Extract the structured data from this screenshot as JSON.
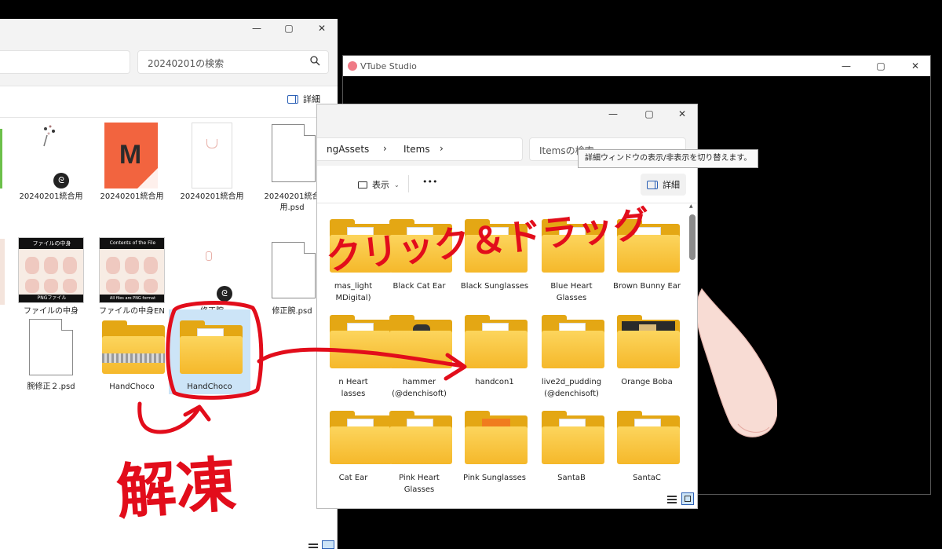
{
  "winA": {
    "search_placeholder": "20240201の検索",
    "details_label": "詳細",
    "items": [
      {
        "label": "20240201統合用"
      },
      {
        "label": "20240201統合用"
      },
      {
        "label": "20240201統合用"
      },
      {
        "label": "20240201統合用.psd"
      },
      {
        "label": "ファイルの中身"
      },
      {
        "label": "ファイルの中身EN"
      },
      {
        "label": "修正腕"
      },
      {
        "label": "修正腕.psd"
      },
      {
        "label": "腕修正２.psd"
      },
      {
        "label": "HandChoco"
      },
      {
        "label": "HandChoco"
      }
    ],
    "thumb_texts": {
      "contents_title": "Contents of the File",
      "contents_footer": "All files are PNG format",
      "jp_title": "ファイルの中身",
      "jp_footer": "PNGファイル",
      "logo_letter": "M"
    }
  },
  "winB": {
    "title": "VTube Studio"
  },
  "winC": {
    "breadcrumb_1": "ngAssets",
    "breadcrumb_2": "Items",
    "search_placeholder": "Itemsの検索",
    "view_label": "表示",
    "more_label": "•••",
    "details_label": "詳細",
    "tooltip": "詳細ウィンドウの表示/非表示を切り替えます。",
    "items": [
      {
        "label": "mas_light\nMDigital)"
      },
      {
        "label": "Black Cat Ear"
      },
      {
        "label": "Black Sunglasses"
      },
      {
        "label": "Blue Heart\nGlasses"
      },
      {
        "label": "Brown Bunny Ear"
      },
      {
        "label": "n Heart\nlasses"
      },
      {
        "label": "hammer\n(@denchisoft)"
      },
      {
        "label": "handcon1"
      },
      {
        "label": "live2d_pudding\n(@denchisoft)"
      },
      {
        "label": "Orange Boba"
      },
      {
        "label": "Cat Ear"
      },
      {
        "label": "Pink Heart\nGlasses"
      },
      {
        "label": "Pink Sunglasses"
      },
      {
        "label": "SantaB"
      },
      {
        "label": "SantaC"
      }
    ]
  },
  "annotations": {
    "drag_text": "クリック＆ドラッグ",
    "unzip_text": "解凍"
  },
  "colors": {
    "annotation_red": "#e20d1b",
    "folder_yellow": "#f5b82a",
    "selection_blue": "#cce4f7"
  }
}
